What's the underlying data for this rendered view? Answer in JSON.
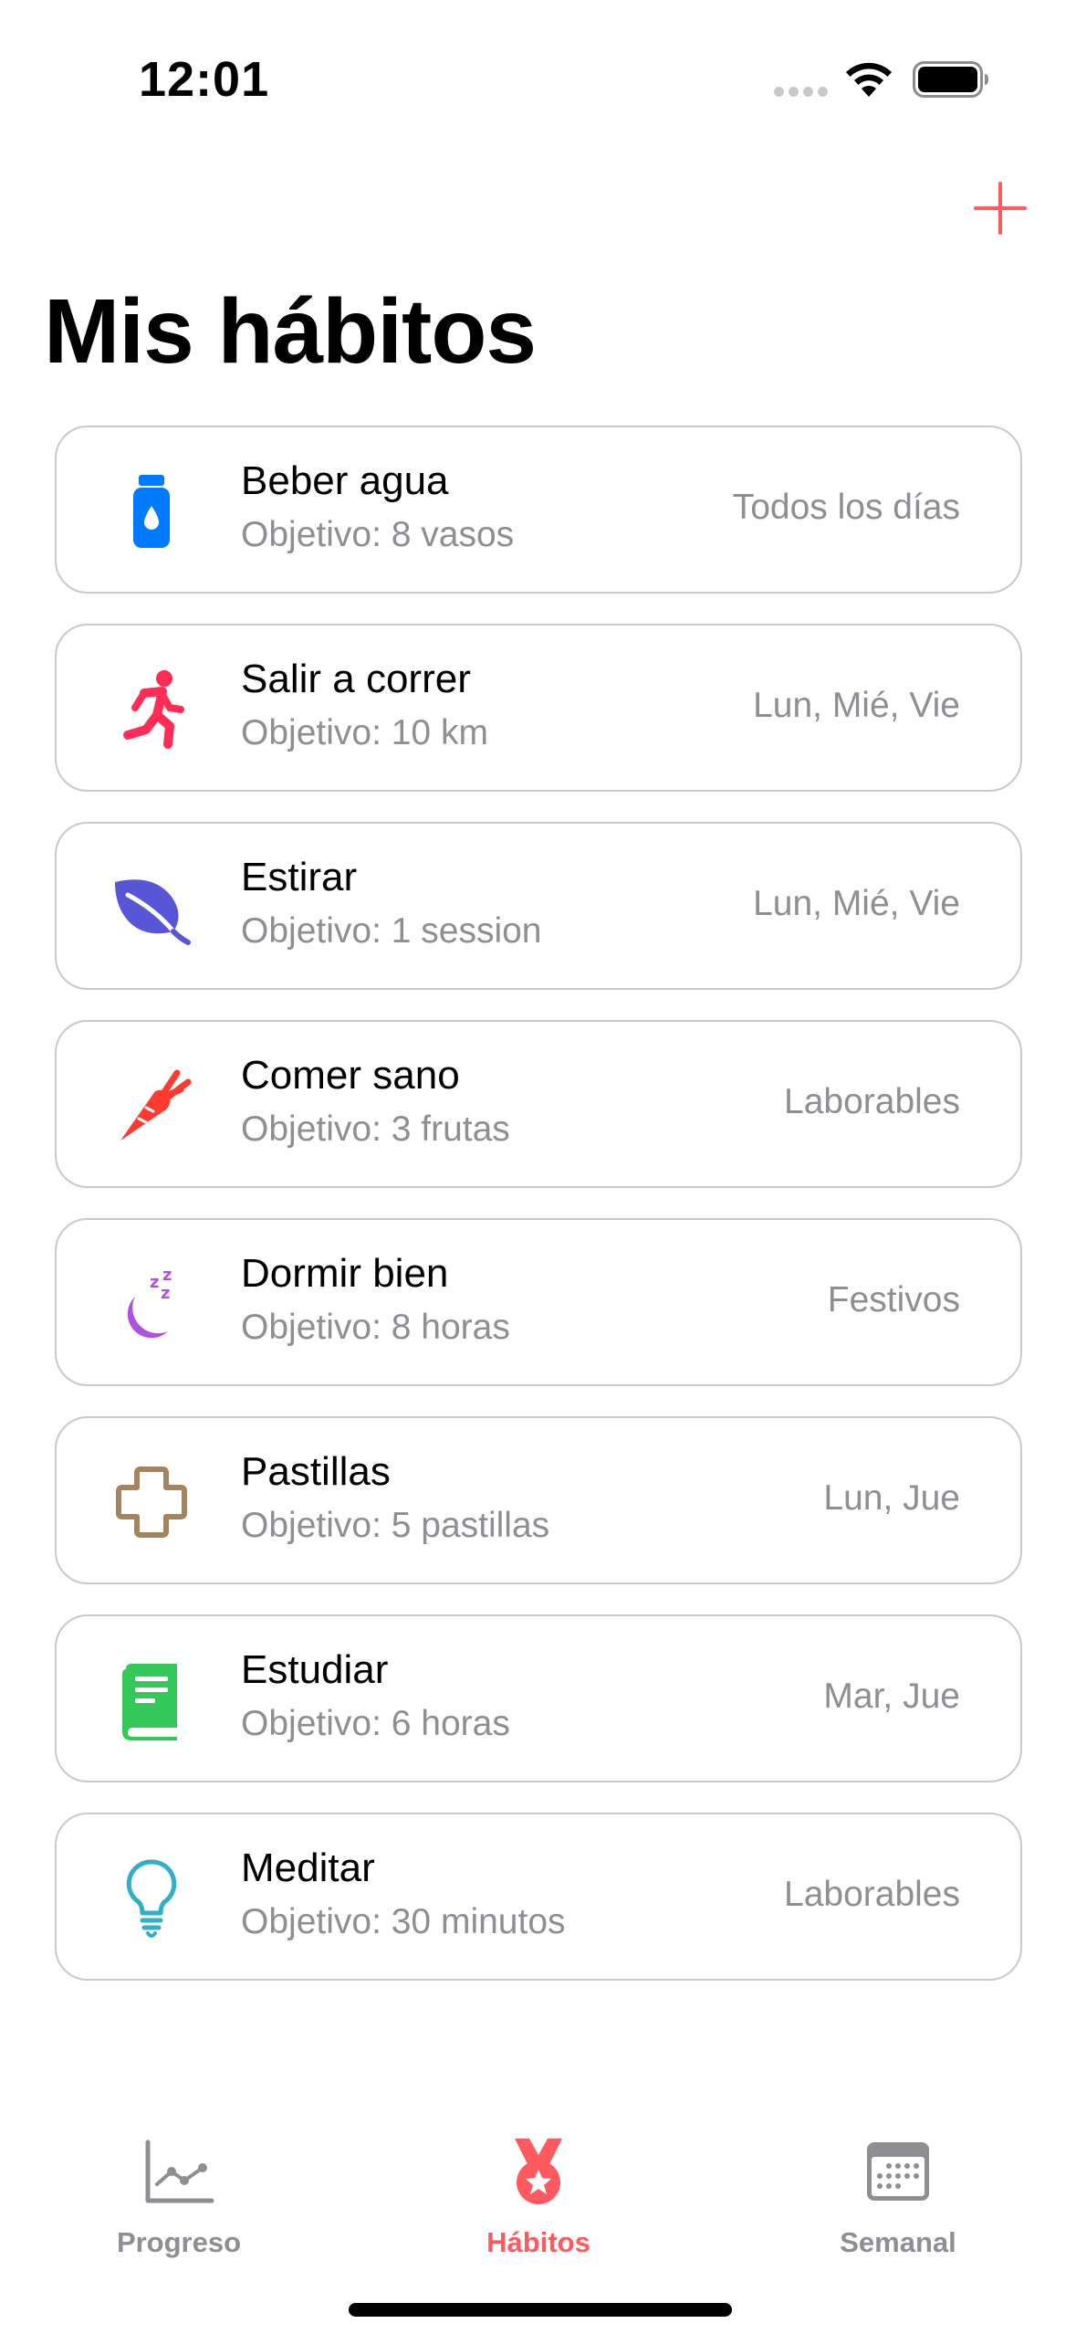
{
  "status_bar": {
    "time": "12:01"
  },
  "header": {
    "add_icon": "plus-icon",
    "title": "Mis hábitos"
  },
  "habits": [
    {
      "name": "Beber agua",
      "goal": "Objetivo: 8 vasos",
      "schedule": "Todos los días",
      "icon": "water-bottle-icon",
      "color": "#007aff"
    },
    {
      "name": "Salir a correr",
      "goal": "Objetivo: 10 km",
      "schedule": "Lun, Mié, Vie",
      "icon": "runner-icon",
      "color": "#ff2d55"
    },
    {
      "name": "Estirar",
      "goal": "Objetivo: 1 session",
      "schedule": "Lun, Mié, Vie",
      "icon": "leaf-icon",
      "color": "#5856d6"
    },
    {
      "name": "Comer sano",
      "goal": "Objetivo: 3 frutas",
      "schedule": "Laborables",
      "icon": "carrot-icon",
      "color": "#ff3b30"
    },
    {
      "name": "Dormir bien",
      "goal": "Objetivo: 8 horas",
      "schedule": "Festivos",
      "icon": "moon-zzz-icon",
      "color": "#af52de"
    },
    {
      "name": "Pastillas",
      "goal": "Objetivo: 5 pastillas",
      "schedule": "Lun, Jue",
      "icon": "medical-cross-icon",
      "color": "#a2845e"
    },
    {
      "name": "Estudiar",
      "goal": "Objetivo: 6 horas",
      "schedule": "Mar, Jue",
      "icon": "book-icon",
      "color": "#34c759"
    },
    {
      "name": "Meditar",
      "goal": "Objetivo: 30 minutos",
      "schedule": "Laborables",
      "icon": "lightbulb-icon",
      "color": "#30b0c7"
    }
  ],
  "tab_bar": {
    "tabs": [
      {
        "label": "Progreso",
        "icon": "chart-line-icon",
        "active": false
      },
      {
        "label": "Hábitos",
        "icon": "medal-icon",
        "active": true
      },
      {
        "label": "Semanal",
        "icon": "calendar-icon",
        "active": false
      }
    ]
  },
  "colors": {
    "accent": "#ff5a5f",
    "secondary_text": "#8e8e93",
    "card_border": "#c9c9cc"
  }
}
